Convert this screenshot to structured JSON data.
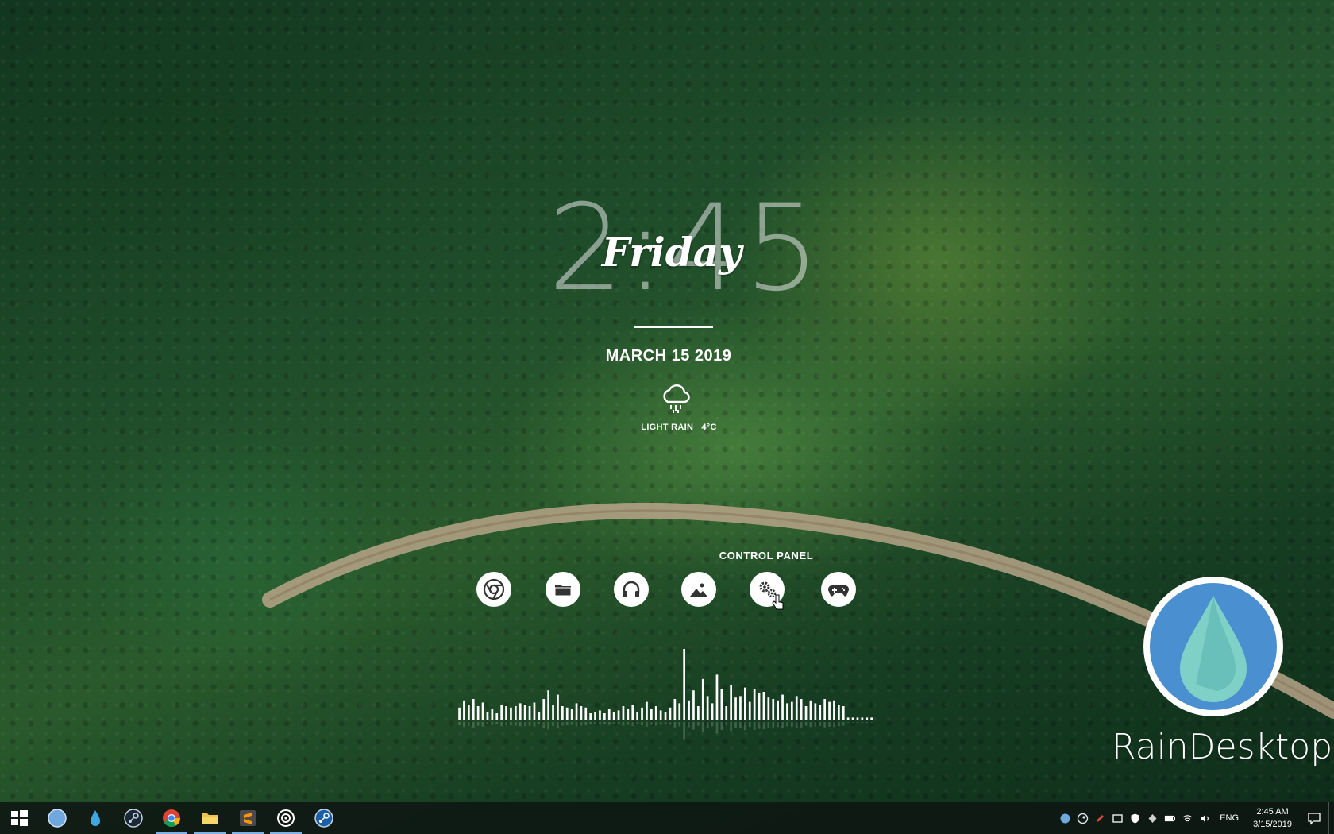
{
  "clock": {
    "time": "2:45",
    "day": "Friday",
    "date": "MARCH 15 2019"
  },
  "weather": {
    "icon": "rain-cloud-icon",
    "condition": "LIGHT RAIN",
    "temperature": "4°C"
  },
  "control_panel": {
    "label": "CONTROL PANEL",
    "launchers": [
      {
        "icon": "chrome-icon"
      },
      {
        "icon": "folder-icon"
      },
      {
        "icon": "headphones-icon"
      },
      {
        "icon": "image-icon"
      },
      {
        "icon": "settings-gears-icon"
      },
      {
        "icon": "gamepad-icon"
      }
    ]
  },
  "audio_visualizer": {
    "bar_levels": [
      0.18,
      0.28,
      0.22,
      0.3,
      0.2,
      0.25,
      0.12,
      0.16,
      0.1,
      0.22,
      0.2,
      0.18,
      0.2,
      0.24,
      0.22,
      0.2,
      0.25,
      0.12,
      0.3,
      0.42,
      0.22,
      0.36,
      0.2,
      0.18,
      0.16,
      0.24,
      0.2,
      0.18,
      0.1,
      0.12,
      0.14,
      0.1,
      0.16,
      0.12,
      0.14,
      0.2,
      0.16,
      0.22,
      0.12,
      0.18,
      0.26,
      0.16,
      0.2,
      0.14,
      0.12,
      0.18,
      0.3,
      0.24,
      1.0,
      0.28,
      0.42,
      0.2,
      0.58,
      0.34,
      0.24,
      0.64,
      0.44,
      0.2,
      0.5,
      0.32,
      0.34,
      0.46,
      0.26,
      0.44,
      0.38,
      0.4,
      0.32,
      0.3,
      0.28,
      0.36,
      0.24,
      0.26,
      0.34,
      0.3,
      0.2,
      0.28,
      0.24,
      0.22,
      0.3,
      0.26,
      0.28,
      0.22,
      0.2,
      0.04,
      0.04,
      0.04,
      0.04,
      0.04,
      0.04
    ]
  },
  "rainmeter": {
    "icon": "raindrop-logo-icon",
    "name": "RainDesktop",
    "colors": {
      "circle": "#4a8fd0",
      "drop": "#8fd6cf"
    }
  },
  "taskbar": {
    "apps": [
      {
        "icon": "windows-start-icon",
        "active": false
      },
      {
        "icon": "circle-app-icon",
        "active": false
      },
      {
        "icon": "rainmeter-drop-icon",
        "active": false
      },
      {
        "icon": "steam-icon",
        "active": false
      },
      {
        "icon": "chrome-icon",
        "active": true
      },
      {
        "icon": "file-explorer-icon",
        "active": true
      },
      {
        "icon": "sublime-text-icon",
        "active": true
      },
      {
        "icon": "target-app-icon",
        "active": true
      },
      {
        "icon": "steam-icon",
        "active": false
      }
    ],
    "tray_icons": [
      "circle-app-icon",
      "steam-icon",
      "pen-icon",
      "window-icon",
      "shield-icon",
      "diamond-icon",
      "battery-icon",
      "wifi-icon",
      "volume-icon"
    ],
    "language": "ENG",
    "time": "2:45 AM",
    "date": "3/15/2019",
    "notification_icon": "notification-icon"
  }
}
